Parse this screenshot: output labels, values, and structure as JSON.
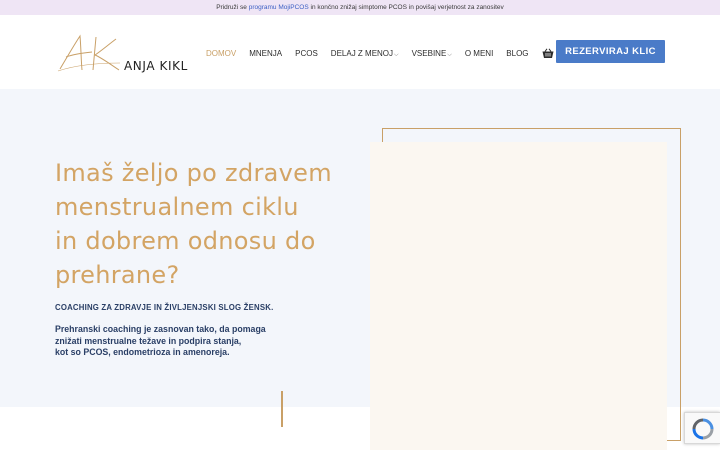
{
  "topbar": {
    "prefix": "Pridruži se ",
    "link": "programu MojiPCOS",
    "suffix": " in končno znižaj simptome PCOS in povišaj verjetnost za zanositev"
  },
  "brand": {
    "name": "ANJA KIKL",
    "monogram": "AK"
  },
  "nav": {
    "items": [
      {
        "label": "DOMOV",
        "active": true
      },
      {
        "label": "MNENJA"
      },
      {
        "label": "PCOS"
      },
      {
        "label": "DELAJ Z MENOJ",
        "dropdown": true
      },
      {
        "label": "VSEBINE",
        "dropdown": true
      },
      {
        "label": "O MENI"
      },
      {
        "label": "BLOG"
      }
    ],
    "cart_icon": "shopping-basket-icon",
    "cta": "REZERVIRAJ KLIC"
  },
  "hero": {
    "headline": [
      "Imaš željo po zdravem",
      "menstrualnem ciklu",
      "in dobrem odnosu do",
      "prehrane?"
    ],
    "subhead": "COACHING ZA ZDRAVJE IN ŽIVLJENJSKI SLOG ŽENSK.",
    "intro": [
      "Prehranski coaching je zasnovan tako, da pomaga",
      "znižati menstrualne težave in podpira stanja,",
      "kot so PCOS, endometrioza in amenoreja."
    ]
  },
  "colors": {
    "gold": "#c9a067",
    "headline": "#d3a464",
    "navy": "#2a3f66",
    "cta": "#4a7bc8",
    "hero_bg": "#f3f6fb"
  },
  "recaptcha_icon": "recaptcha-badge-icon"
}
